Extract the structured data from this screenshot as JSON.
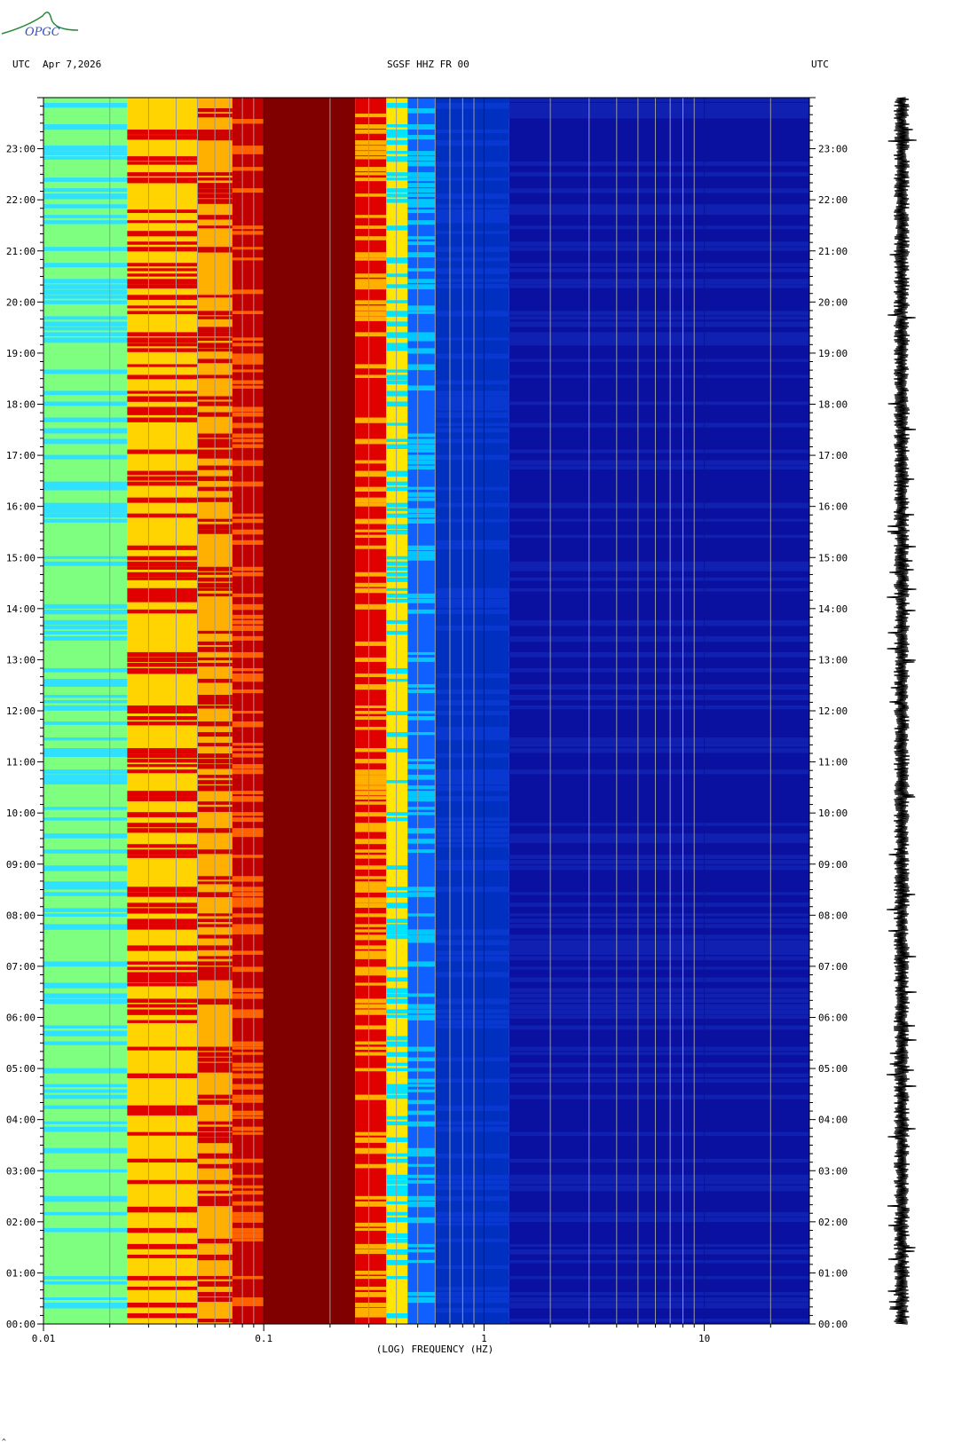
{
  "header": {
    "left_tz": "UTC",
    "date": "Apr 7,2026",
    "station": "SGSF HHZ FR 00",
    "right_tz": "UTC"
  },
  "logo": {
    "text": "OPGC"
  },
  "corner_mark": "^",
  "colors": {
    "dark_red": "#800000",
    "red": "#e00000",
    "orange": "#ff8000",
    "yellow": "#ffe600",
    "cyan": "#00e5ff",
    "blue": "#0030c0",
    "dark_blue": "#0a10a0"
  },
  "chart_data": {
    "type": "heatmap",
    "xlabel": "(LOG) FREQUENCY (HZ)",
    "x_scale": "log",
    "xlim": [
      0.01,
      30
    ],
    "x_ticks": [
      {
        "value": 0.01,
        "label": "0.01"
      },
      {
        "value": 0.1,
        "label": "0.1"
      },
      {
        "value": 1,
        "label": "1"
      },
      {
        "value": 10,
        "label": "10"
      }
    ],
    "y_ticks": [
      {
        "hour": 0,
        "label": "00:00"
      },
      {
        "hour": 1,
        "label": "01:00"
      },
      {
        "hour": 2,
        "label": "02:00"
      },
      {
        "hour": 3,
        "label": "03:00"
      },
      {
        "hour": 4,
        "label": "04:00"
      },
      {
        "hour": 5,
        "label": "05:00"
      },
      {
        "hour": 6,
        "label": "06:00"
      },
      {
        "hour": 7,
        "label": "07:00"
      },
      {
        "hour": 8,
        "label": "08:00"
      },
      {
        "hour": 9,
        "label": "09:00"
      },
      {
        "hour": 10,
        "label": "10:00"
      },
      {
        "hour": 11,
        "label": "11:00"
      },
      {
        "hour": 12,
        "label": "12:00"
      },
      {
        "hour": 13,
        "label": "13:00"
      },
      {
        "hour": 14,
        "label": "14:00"
      },
      {
        "hour": 15,
        "label": "15:00"
      },
      {
        "hour": 16,
        "label": "16:00"
      },
      {
        "hour": 17,
        "label": "17:00"
      },
      {
        "hour": 18,
        "label": "18:00"
      },
      {
        "hour": 19,
        "label": "19:00"
      },
      {
        "hour": 20,
        "label": "20:00"
      },
      {
        "hour": 21,
        "label": "21:00"
      },
      {
        "hour": 22,
        "label": "22:00"
      },
      {
        "hour": 23,
        "label": "23:00"
      }
    ],
    "ylim_hours": [
      0,
      24
    ],
    "bands": [
      {
        "f_from": 0.01,
        "f_to": 0.024,
        "color": "#7fff80",
        "alt": "#30e0ff"
      },
      {
        "f_from": 0.024,
        "f_to": 0.05,
        "color": "#ffd400",
        "alt": "#e00000"
      },
      {
        "f_from": 0.05,
        "f_to": 0.072,
        "color": "#ffb000",
        "alt": "#d00000"
      },
      {
        "f_from": 0.072,
        "f_to": 0.1,
        "color": "#c00000",
        "alt": "#ff6000"
      },
      {
        "f_from": 0.1,
        "f_to": 0.26,
        "color": "#800000",
        "alt": "#800000"
      },
      {
        "f_from": 0.26,
        "f_to": 0.36,
        "color": "#e00000",
        "alt": "#ffb000"
      },
      {
        "f_from": 0.36,
        "f_to": 0.45,
        "color": "#ffe600",
        "alt": "#00e5ff"
      },
      {
        "f_from": 0.45,
        "f_to": 0.6,
        "color": "#1060ff",
        "alt": "#00c8ff"
      },
      {
        "f_from": 0.6,
        "f_to": 1.3,
        "color": "#0030c0",
        "alt": "#0838d0"
      },
      {
        "f_from": 1.3,
        "f_to": 30,
        "color": "#0a10a0",
        "alt": "#1020b0"
      }
    ],
    "grid_frequencies": [
      0.02,
      0.03,
      0.04,
      0.05,
      0.06,
      0.07,
      0.08,
      0.09,
      0.2,
      0.3,
      0.4,
      0.5,
      0.6,
      0.7,
      0.8,
      0.9,
      2,
      3,
      4,
      5,
      6,
      7,
      8,
      9,
      20
    ]
  }
}
